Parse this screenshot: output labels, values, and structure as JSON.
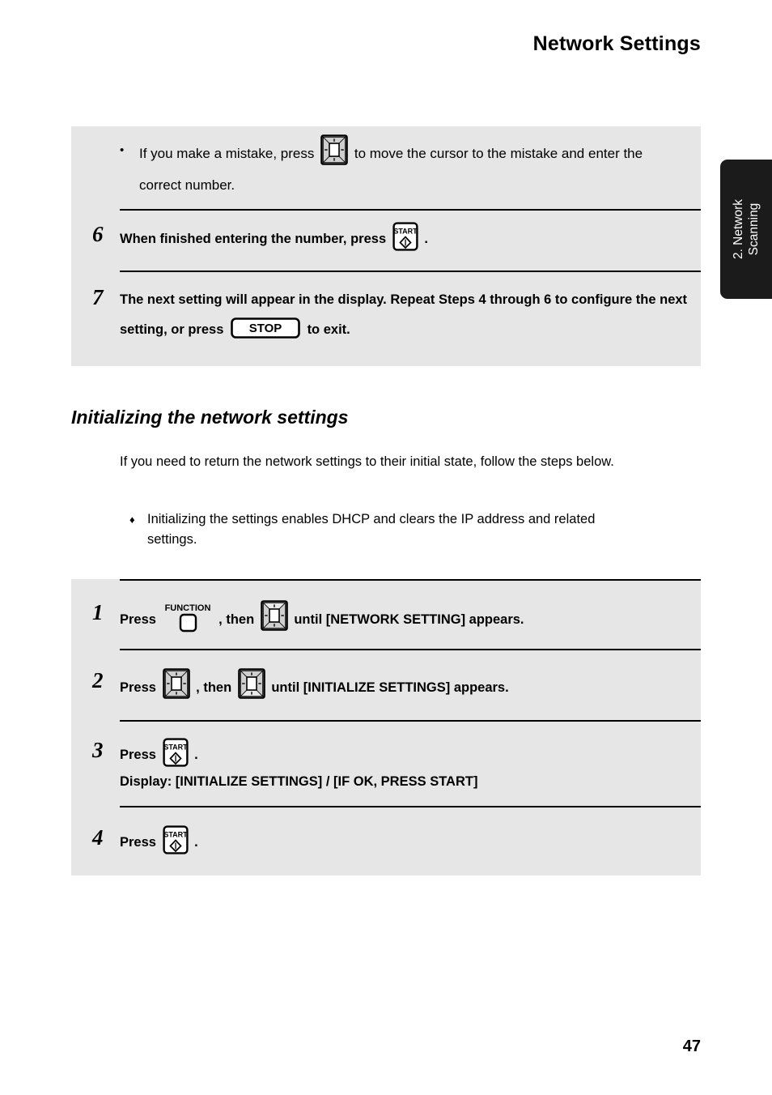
{
  "header": {
    "title": "Network Settings"
  },
  "side_tab": {
    "line1": "2. Network",
    "line2": "Scanning",
    "background": "#1b1b1b",
    "text_color": "#ffffff"
  },
  "panel_one": {
    "note": {
      "bullet": "•",
      "text_before": "If you make a mistake, press",
      "icon": "arrow-key-icon",
      "text_after": "to move the cursor to the mistake and enter the correct number."
    },
    "steps": [
      {
        "number": "6",
        "text_before": "When finished entering the number, press",
        "icon": "start-key-icon",
        "text_after": "."
      },
      {
        "number": "7",
        "text_before": "The next setting will appear in the display. Repeat Steps 4 through 6 to configure the next setting, or press",
        "icon": "stop-key-icon",
        "text_after": "to exit."
      }
    ]
  },
  "section": {
    "heading": "Initializing the network settings",
    "paragraph": "If you need to return the network settings to their initial state, follow the steps below.",
    "note_marker": "♦",
    "note": "Initializing the settings enables DHCP and clears the IP address and related settings."
  },
  "panel_two": {
    "steps": [
      {
        "number": "1",
        "press_label": "Press",
        "icon1": "function-key-icon",
        "icon1_label": "FUNCTION",
        "then_label": ", then",
        "icon2": "arrow-key-up-icon",
        "text_after": "until [NETWORK SETTING] appears."
      },
      {
        "number": "2",
        "press_label": "Press",
        "icon1": "arrow-key-icon",
        "then_label": ", then",
        "icon2": "arrow-key-down-icon",
        "text_after": "until [INITIALIZE SETTINGS] appears."
      },
      {
        "number": "3",
        "press_label": "Press",
        "icon1": "start-key-icon",
        "text_after": ".",
        "display_line": "Display: [INITIALIZE SETTINGS] / [IF OK, PRESS START]"
      },
      {
        "number": "4",
        "press_label": "Press",
        "icon1": "start-key-icon",
        "text_after": "."
      }
    ]
  },
  "footer": {
    "page_number": "47"
  },
  "colors": {
    "panel_background": "#e6e6e6",
    "page_background": "#ffffff",
    "rule": "#000000",
    "key_face": "#ffffff",
    "key_shade": "#cfcfcf"
  }
}
